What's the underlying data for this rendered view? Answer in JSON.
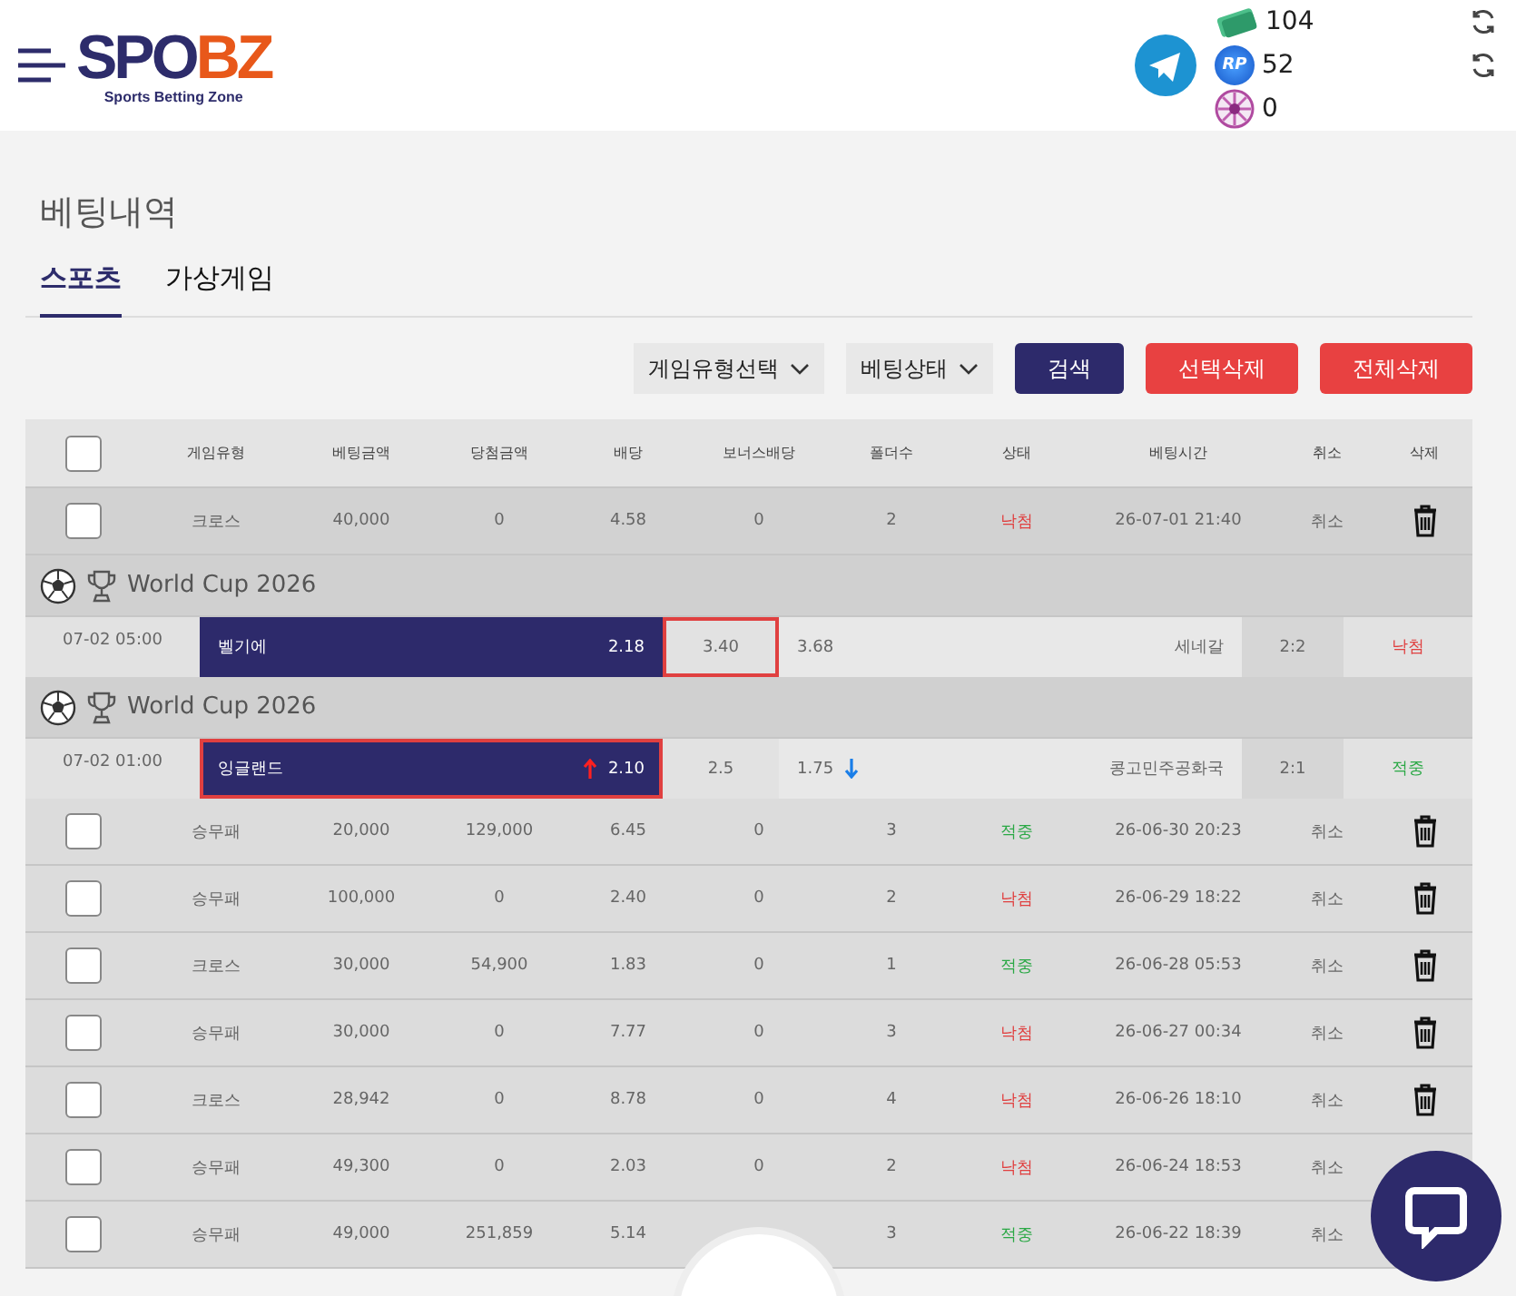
{
  "header": {
    "logo": {
      "primary": "SPO",
      "accent": "BZ",
      "tagline": "Sports Betting Zone"
    },
    "balances": [
      {
        "kind": "cash",
        "value": "104"
      },
      {
        "kind": "points",
        "badge": "RP",
        "value": "52"
      },
      {
        "kind": "wheel",
        "value": "0"
      }
    ]
  },
  "page_title": "베팅내역",
  "tabs": [
    {
      "label": "스포츠",
      "selected": true
    },
    {
      "label": "가상게임",
      "selected": false
    }
  ],
  "filters": {
    "dropdowns": [
      "게임유형선택",
      "베팅상태"
    ],
    "buttons": [
      {
        "label": "검색",
        "kind": "primary"
      },
      {
        "label": "선택삭제",
        "kind": "danger"
      },
      {
        "label": "전체삭제",
        "kind": "danger"
      }
    ]
  },
  "table": {
    "select_all_checked": false,
    "columns": [
      "게임유형",
      "베팅금액",
      "당첨금액",
      "배당",
      "보너스배당",
      "폴더수",
      "상태",
      "베팅시간",
      "취소",
      "삭제"
    ],
    "rows": [
      {
        "kind": "bet",
        "checked": false,
        "type": "크로스",
        "amount": "40,000",
        "payout": "0",
        "odds": "4.58",
        "bonus": "0",
        "folders": "2",
        "status": {
          "label": "낙첨",
          "kind": "lose"
        },
        "time": "26-07-01 21:40",
        "cancel": "취소",
        "delete": true
      },
      {
        "kind": "league",
        "name": "World Cup 2026"
      },
      {
        "kind": "match",
        "time": "07-02 05:00",
        "home": {
          "name": "벨기에",
          "odds": "2.18",
          "selected": false
        },
        "draw": {
          "odds": "3.40",
          "selected": true
        },
        "away": {
          "name": "세네갈",
          "odds": "3.68",
          "selected": false
        },
        "score": "2:2",
        "result": {
          "label": "낙첨",
          "kind": "lose"
        }
      },
      {
        "kind": "league",
        "name": "World Cup 2026"
      },
      {
        "kind": "match",
        "time": "07-02 01:00",
        "home": {
          "name": "잉글랜드",
          "odds": "2.10",
          "odds_up": true,
          "selected": true
        },
        "draw": {
          "odds": "2.5",
          "selected": false
        },
        "away": {
          "name": "콩고민주공화국",
          "odds": "1.75",
          "odds_down": true,
          "selected": false
        },
        "score": "2:1",
        "result": {
          "label": "적중",
          "kind": "win"
        }
      },
      {
        "kind": "bet",
        "checked": false,
        "type": "승무패",
        "amount": "20,000",
        "payout": "129,000",
        "odds": "6.45",
        "bonus": "0",
        "folders": "3",
        "status": {
          "label": "적중",
          "kind": "win"
        },
        "time": "26-06-30 20:23",
        "cancel": "취소",
        "delete": true
      },
      {
        "kind": "bet",
        "checked": false,
        "type": "승무패",
        "amount": "100,000",
        "payout": "0",
        "odds": "2.40",
        "bonus": "0",
        "folders": "2",
        "status": {
          "label": "낙첨",
          "kind": "lose"
        },
        "time": "26-06-29 18:22",
        "cancel": "취소",
        "delete": true
      },
      {
        "kind": "bet",
        "checked": false,
        "type": "크로스",
        "amount": "30,000",
        "payout": "54,900",
        "odds": "1.83",
        "bonus": "0",
        "folders": "1",
        "status": {
          "label": "적중",
          "kind": "win"
        },
        "time": "26-06-28 05:53",
        "cancel": "취소",
        "delete": true
      },
      {
        "kind": "bet",
        "checked": false,
        "type": "승무패",
        "amount": "30,000",
        "payout": "0",
        "odds": "7.77",
        "bonus": "0",
        "folders": "3",
        "status": {
          "label": "낙첨",
          "kind": "lose"
        },
        "time": "26-06-27 00:34",
        "cancel": "취소",
        "delete": true
      },
      {
        "kind": "bet",
        "checked": false,
        "type": "크로스",
        "amount": "28,942",
        "payout": "0",
        "odds": "8.78",
        "bonus": "0",
        "folders": "4",
        "status": {
          "label": "낙첨",
          "kind": "lose"
        },
        "time": "26-06-26 18:10",
        "cancel": "취소",
        "delete": true
      },
      {
        "kind": "bet",
        "checked": false,
        "type": "승무패",
        "amount": "49,300",
        "payout": "0",
        "odds": "2.03",
        "bonus": "0",
        "folders": "2",
        "status": {
          "label": "낙첨",
          "kind": "lose"
        },
        "time": "26-06-24 18:53",
        "cancel": "취소",
        "delete": false
      },
      {
        "kind": "bet",
        "checked": false,
        "type": "승무패",
        "amount": "49,000",
        "payout": "251,859",
        "odds": "5.14",
        "folders": "3",
        "status": {
          "label": "적중",
          "kind": "win"
        },
        "time": "26-06-22 18:39",
        "cancel": "취소",
        "delete": false
      }
    ]
  }
}
